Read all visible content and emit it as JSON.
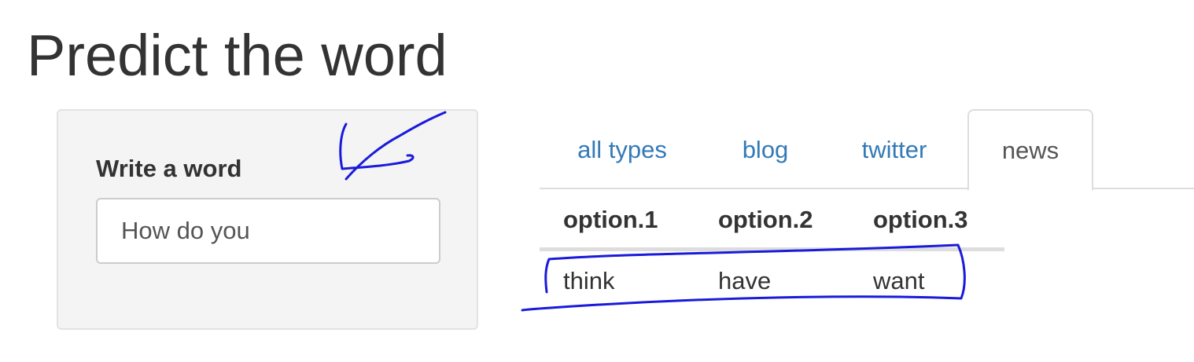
{
  "page": {
    "title": "Predict the word"
  },
  "sidebar": {
    "input_label": "Write a word",
    "input_value": "How do you"
  },
  "tabs": [
    {
      "label": "all types",
      "active": false
    },
    {
      "label": "blog",
      "active": false
    },
    {
      "label": "twitter",
      "active": false
    },
    {
      "label": "news",
      "active": true
    }
  ],
  "table": {
    "headers": [
      "option.1",
      "option.2",
      "option.3"
    ],
    "rows": [
      [
        "think",
        "have",
        "want"
      ]
    ]
  },
  "colors": {
    "link": "#337ab7",
    "annotation": "#1a1adb",
    "text": "#333333"
  }
}
